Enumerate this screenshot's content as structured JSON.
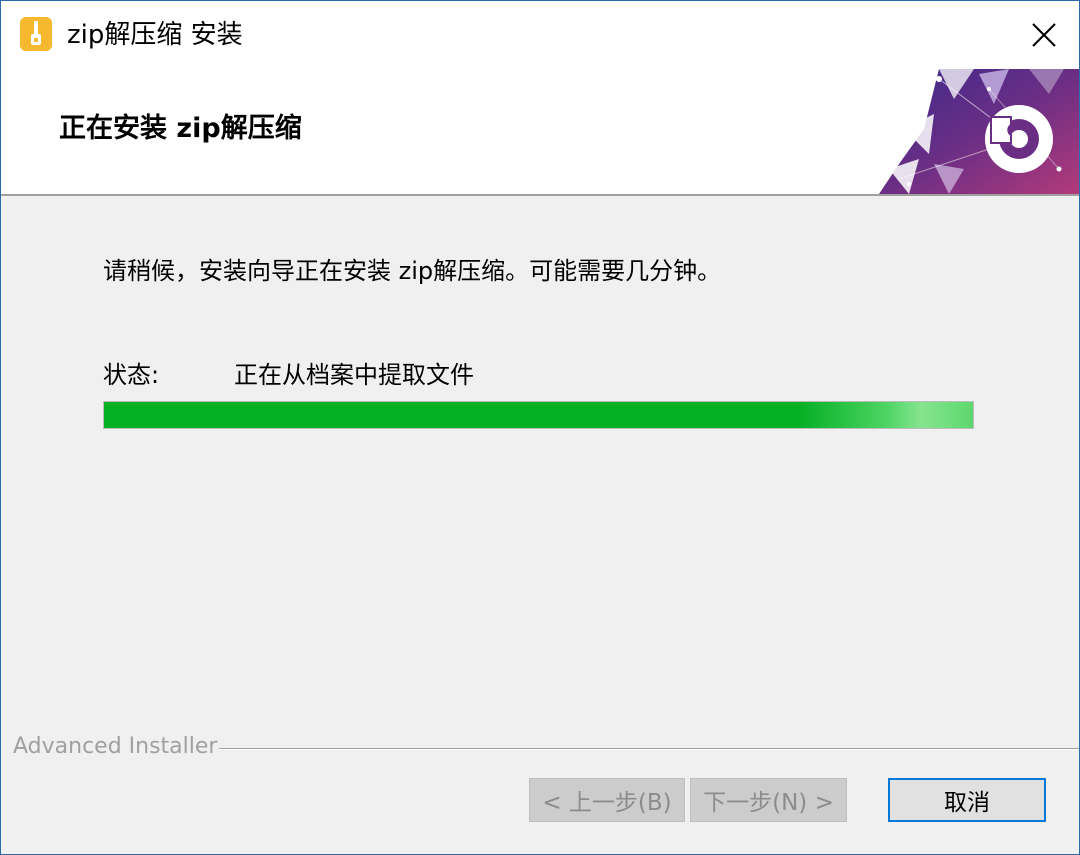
{
  "window": {
    "title": "zip解压缩 安装",
    "app_icon": "zipper-icon",
    "close_icon": "close-icon"
  },
  "header": {
    "title": "正在安装 zip解压缩",
    "graphic": "decorative-banner-graphic"
  },
  "body": {
    "message": "请稍候，安装向导正在安装 zip解压缩。可能需要几分钟。",
    "status_label": "状态:",
    "status_text": "正在从档案中提取文件",
    "progress_fraction": 1.0
  },
  "footer": {
    "brand": "Advanced Installer",
    "back_label": "< 上一步(B)",
    "next_label": "下一步(N) >",
    "cancel_label": "取消"
  },
  "colors": {
    "progress_green": "#06b025",
    "focus_blue": "#0078d7",
    "banner_purple": "#7b2a7f"
  }
}
